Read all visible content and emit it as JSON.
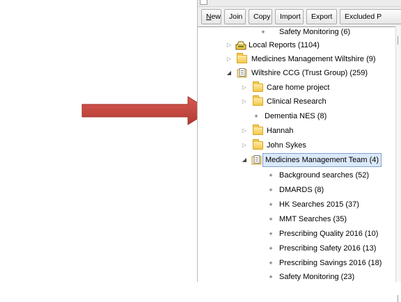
{
  "toolbar": {
    "buttons": [
      {
        "mnemonic": "N",
        "rest": "ew"
      },
      {
        "label": "Join"
      },
      {
        "label": "Copy"
      },
      {
        "label": "Import"
      },
      {
        "label": "Export"
      },
      {
        "label": "Excluded P"
      }
    ]
  },
  "tree": {
    "items": [
      {
        "label": "Safety Monitoring (6)"
      },
      {
        "label": "Local Reports (1104)",
        "icon": "reports-icon"
      },
      {
        "label": "Medicines Management Wiltshire (9)",
        "icon": "folder-icon"
      },
      {
        "label": "Wiltshire CCG (Trust Group) (259)",
        "icon": "document-folder-icon"
      },
      {
        "label": "Care home project",
        "icon": "folder-icon"
      },
      {
        "label": "Clinical Research",
        "icon": "folder-icon"
      },
      {
        "label": "Dementia NES (8)"
      },
      {
        "label": "Hannah",
        "icon": "folder-icon"
      },
      {
        "label": "John Sykes",
        "icon": "folder-icon"
      },
      {
        "label": "Medicines Management Team (4)",
        "icon": "document-folder-icon",
        "selected": true
      },
      {
        "label": "Background searches (52)"
      },
      {
        "label": "DMARDS (8)"
      },
      {
        "label": "HK Searches 2015 (37)"
      },
      {
        "label": "MMT Searches (35)"
      },
      {
        "label": "Prescribing Quality 2016 (10)"
      },
      {
        "label": "Prescribing Safety 2016 (13)"
      },
      {
        "label": "Prescribing Savings 2016 (18)"
      },
      {
        "label": "Safety Monitoring (23)"
      }
    ]
  },
  "colors": {
    "arrow": "#c8443c",
    "selection_bg": "#dbe9fb",
    "selection_border": "#7da2ce",
    "folder": "#f2c94c"
  }
}
